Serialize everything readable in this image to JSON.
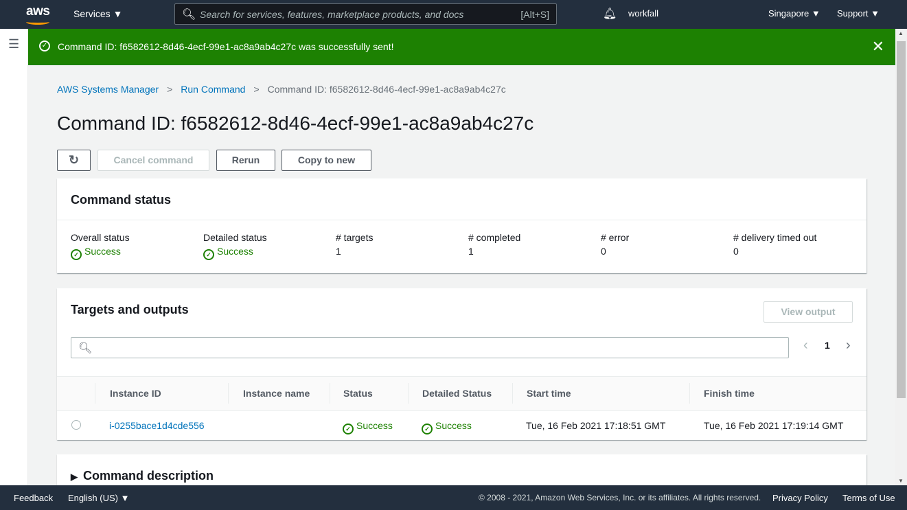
{
  "nav": {
    "logo": "aws",
    "services": "Services ▼",
    "search_placeholder": "Search for services, features, marketplace products, and docs",
    "search_shortcut": "[Alt+S]",
    "user": "workfall",
    "region": "Singapore ▼",
    "support": "Support ▼"
  },
  "flash": {
    "message": "Command ID: f6582612-8d46-4ecf-99e1-ac8a9ab4c27c was successfully sent!"
  },
  "breadcrumb": [
    "AWS Systems Manager",
    "Run Command",
    "Command ID: f6582612-8d46-4ecf-99e1-ac8a9ab4c27c"
  ],
  "title": "Command ID: f6582612-8d46-4ecf-99e1-ac8a9ab4c27c",
  "buttons": {
    "cancel": "Cancel command",
    "rerun": "Rerun",
    "copy": "Copy to new",
    "view_output": "View output"
  },
  "status": {
    "heading": "Command status",
    "items": [
      {
        "label": "Overall status",
        "value": "Success"
      },
      {
        "label": "Detailed status",
        "value": "Success"
      },
      {
        "label": "# targets",
        "value": "1"
      },
      {
        "label": "# completed",
        "value": "1"
      },
      {
        "label": "# error",
        "value": "0"
      },
      {
        "label": "# delivery timed out",
        "value": "0"
      }
    ]
  },
  "targets": {
    "heading": "Targets and outputs",
    "page": "1",
    "columns": [
      "Instance ID",
      "Instance name",
      "Status",
      "Detailed Status",
      "Start time",
      "Finish time"
    ],
    "rows": [
      {
        "instance_id": "i-0255bace1d4cde556",
        "instance_name": "",
        "status": "Success",
        "detailed_status": "Success",
        "start": "Tue, 16 Feb 2021 17:18:51 GMT",
        "finish": "Tue, 16 Feb 2021 17:19:14 GMT"
      }
    ]
  },
  "description": {
    "heading": "Command description"
  },
  "footer": {
    "feedback": "Feedback",
    "language": "English (US) ▼",
    "copyright": "© 2008 - 2021, Amazon Web Services, Inc. or its affiliates. All rights reserved.",
    "privacy": "Privacy Policy",
    "terms": "Terms of Use"
  }
}
